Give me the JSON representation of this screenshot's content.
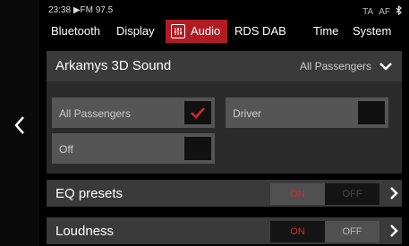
{
  "status": {
    "time": "23:38",
    "source": "FM 97.5",
    "ta": "TA",
    "af": "AF"
  },
  "tabs": [
    {
      "label": "Bluetooth"
    },
    {
      "label": "Display"
    },
    {
      "label": "Audio",
      "active": true
    },
    {
      "label": "RDS DAB"
    },
    {
      "label": "Time"
    },
    {
      "label": "System"
    }
  ],
  "panel": {
    "title": "Arkamys 3D Sound",
    "value": "All Passengers",
    "options": [
      {
        "label": "All Passengers",
        "checked": true
      },
      {
        "label": "Driver",
        "checked": false
      },
      {
        "label": "Off",
        "checked": false
      }
    ]
  },
  "rows": [
    {
      "label": "EQ presets",
      "on": "ON",
      "off": "OFF",
      "state": "on"
    },
    {
      "label": "Loudness",
      "on": "ON",
      "off": "OFF",
      "state": "off"
    }
  ],
  "colors": {
    "accent": "#b01c22",
    "check": "#d7262c"
  }
}
